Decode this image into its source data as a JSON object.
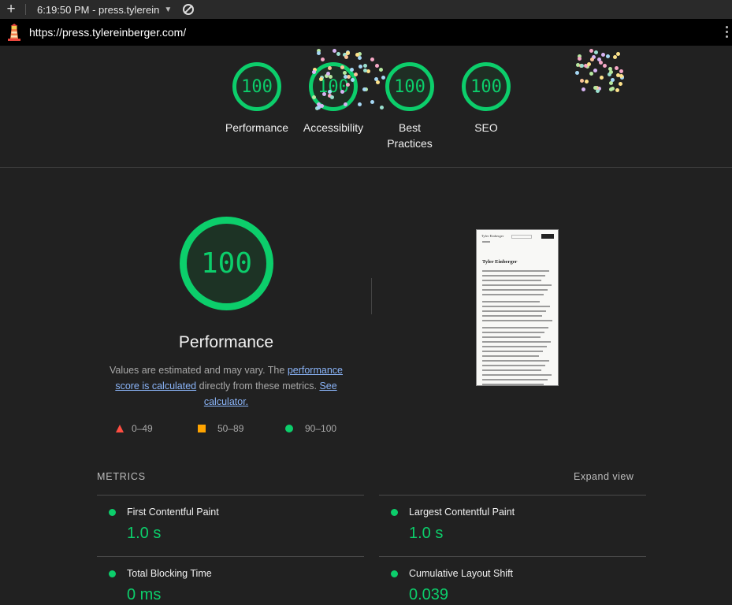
{
  "browser": {
    "tab_title": "6:19:50 PM - press.tylerein",
    "url": "https://press.tylereinberger.com/"
  },
  "summary_gauges": [
    {
      "score": "100",
      "label": "Performance"
    },
    {
      "score": "100",
      "label": "Accessibility"
    },
    {
      "score": "100",
      "label": "Best Practices"
    },
    {
      "score": "100",
      "label": "SEO"
    }
  ],
  "performance": {
    "score": "100",
    "title": "Performance",
    "desc_prefix": "Values are estimated and may vary. The ",
    "desc_link1": "performance score is calculated",
    "desc_middle": " directly from these metrics. ",
    "desc_link2": "See calculator."
  },
  "legend": {
    "fail": "0–49",
    "average": "50–89",
    "pass": "90–100",
    "colors": {
      "fail": "#ff4e42",
      "average": "#ffa400",
      "pass": "#0cce6b"
    }
  },
  "thumbnail": {
    "site_name": "Tyler Einberger",
    "heading": "Tyler Einberger"
  },
  "metrics": {
    "heading": "METRICS",
    "expand_label": "Expand view",
    "items": [
      {
        "name": "First Contentful Paint",
        "value": "1.0 s"
      },
      {
        "name": "Largest Contentful Paint",
        "value": "1.0 s"
      },
      {
        "name": "Total Blocking Time",
        "value": "0 ms"
      },
      {
        "name": "Cumulative Layout Shift",
        "value": "0.039"
      }
    ]
  }
}
